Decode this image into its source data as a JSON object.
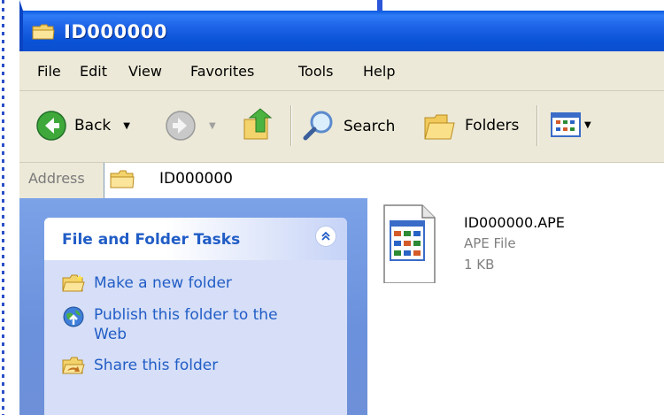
{
  "window": {
    "title": "ID000000"
  },
  "menu": [
    "File",
    "Edit",
    "View",
    "Favorites",
    "Tools",
    "Help"
  ],
  "toolbar": {
    "back_label": "Back",
    "search_label": "Search",
    "folders_label": "Folders"
  },
  "address": {
    "label": "Address",
    "value": "ID000000"
  },
  "tasks": {
    "title": "File and Folder Tasks",
    "items": [
      "Make a new folder",
      "Publish this folder to the Web",
      "Share this folder"
    ]
  },
  "file": {
    "name": "ID000000.APE",
    "type": "APE File",
    "size": "1 KB"
  }
}
